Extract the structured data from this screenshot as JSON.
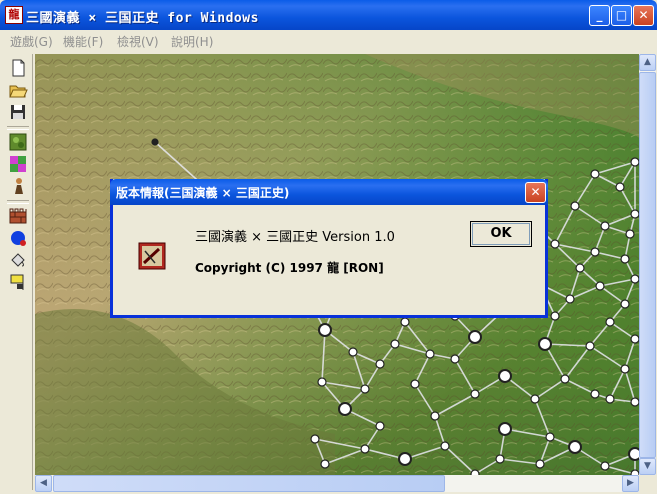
{
  "window": {
    "title": "三國演義 × 三国正史 for Windows",
    "icon_char": "龍",
    "controls": {
      "minimize": "_",
      "maximize": "□",
      "close": "✕"
    }
  },
  "menu": [
    {
      "label": "遊戲(G)"
    },
    {
      "label": "機能(F)"
    },
    {
      "label": "檢視(V)"
    },
    {
      "label": "說明(H)"
    }
  ],
  "toolbar": [
    {
      "icon": "new-file-icon"
    },
    {
      "icon": "open-folder-icon"
    },
    {
      "icon": "save-disk-icon"
    },
    {
      "icon": "terrain-map-icon"
    },
    {
      "icon": "region-color-icon"
    },
    {
      "icon": "figure-icon"
    },
    {
      "icon": "castle-wall-icon"
    },
    {
      "icon": "blue-globe-icon"
    },
    {
      "icon": "paint-bucket-icon"
    },
    {
      "icon": "flag-icon"
    }
  ],
  "dialog": {
    "title": "版本情報(三国演義 × 三国正史)",
    "line1": "三國演義 × 三國正史 Version 1.0",
    "line2": "Copyright (C) 1997 龍 [RON]",
    "ok_label": "OK",
    "icon": "scroll-book-icon"
  },
  "colors": {
    "titlebar": "#0a5ce8",
    "close_button": "#d9532c",
    "window_bg": "#ece9d8"
  }
}
